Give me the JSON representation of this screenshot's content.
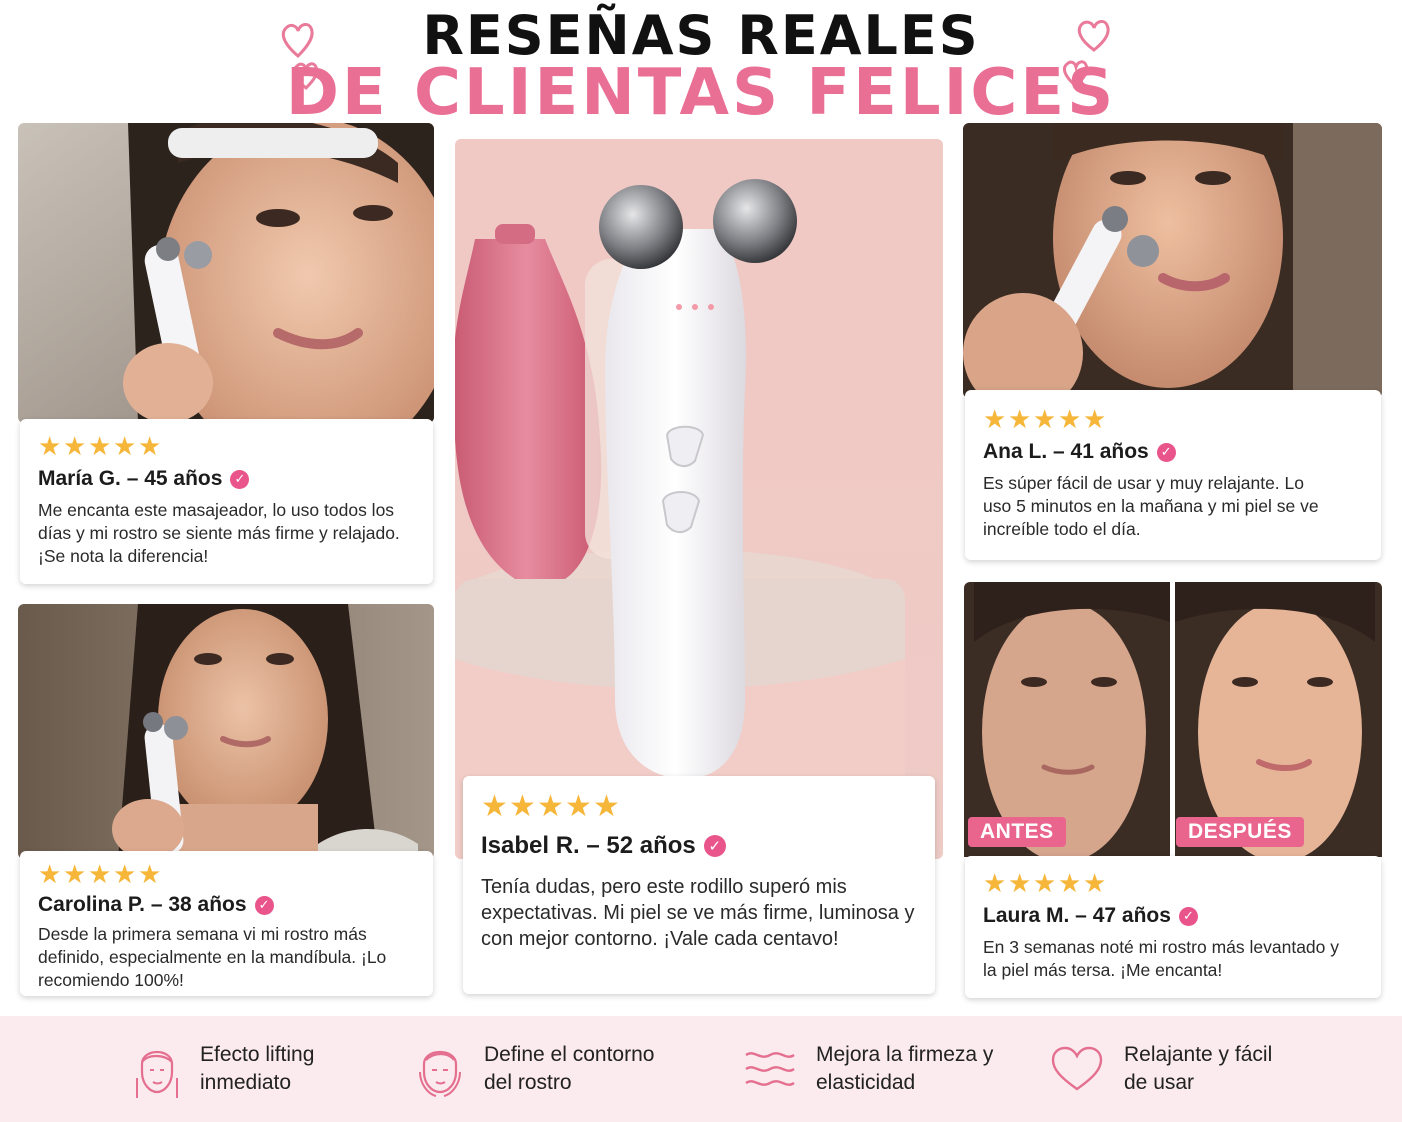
{
  "header": {
    "line1": "RESEÑAS REALES",
    "line2": "DE CLIENTAS FELICES",
    "accent_color": "#ea6f95"
  },
  "reviews": [
    {
      "stars": 5,
      "name": "María G. – 45 años",
      "text": "Me encanta este masajeador, lo uso todos los días y mi rostro se siente más firme y relajado. ¡Se nota la diferencia!"
    },
    {
      "stars": 5,
      "name": "Carolina P. – 38 años",
      "text": "Desde la primera semana vi mi rostro más definido, especialmente en la mandíbula. ¡Lo recomiendo 100%!"
    },
    {
      "stars": 5,
      "name": "Isabel R. – 52 años",
      "text": "Tenía dudas, pero este rodillo superó mis expectativas. Mi piel se ve más firme, luminosa y con mejor contorno. ¡Vale cada centavo!"
    },
    {
      "stars": 5,
      "name": "Ana L. – 41 años",
      "text": "Es súper fácil de usar y muy relajante. Lo uso 5 minutos en la mañana y mi piel se ve increíble todo el día."
    },
    {
      "stars": 5,
      "name": "Laura M. – 47 años",
      "text": "En 3 semanas noté mi rostro más levantado y la piel más tersa. ¡Me encanta!"
    }
  ],
  "before_after": {
    "before_label": "ANTES",
    "after_label": "DESPUÉS"
  },
  "star_glyph": "★",
  "verified_glyph": "✓",
  "benefits": [
    {
      "icon": "face-lift-icon",
      "label": "Efecto lifting inmediato"
    },
    {
      "icon": "face-contour-icon",
      "label": "Define el contorno del rostro"
    },
    {
      "icon": "waves-icon",
      "label": "Mejora la firmeza y elasticidad"
    },
    {
      "icon": "heart-icon",
      "label": "Relajante y fácil de usar"
    }
  ],
  "colors": {
    "star": "#f6b63a",
    "verified": "#e9558a",
    "footer_bg": "#fbeaee",
    "tag": "#e9658e"
  }
}
